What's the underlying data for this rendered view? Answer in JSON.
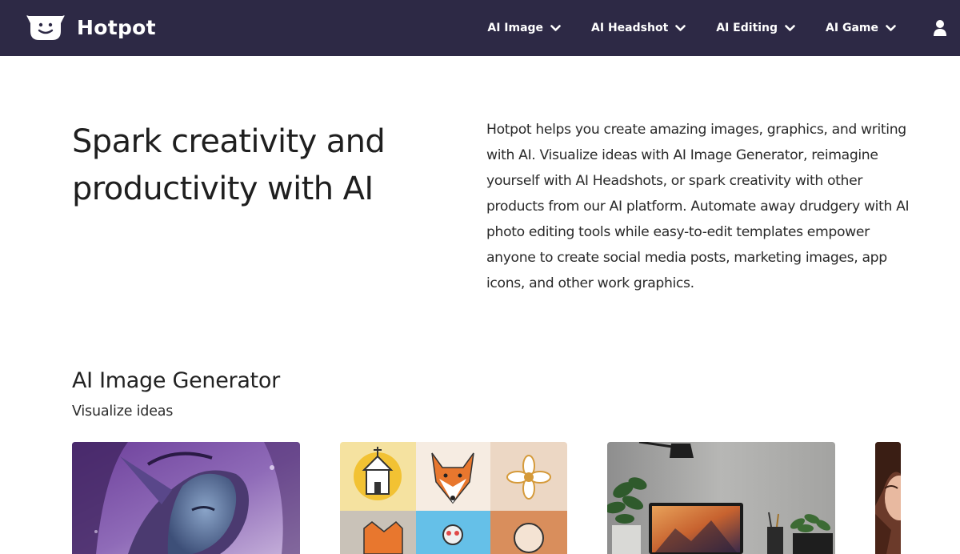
{
  "header": {
    "brand": "Hotpot",
    "logo_icon": "smiling-pot-icon",
    "nav": [
      {
        "label": "AI Image"
      },
      {
        "label": "AI Headshot"
      },
      {
        "label": "AI Editing"
      },
      {
        "label": "AI Game"
      }
    ],
    "user_icon": "user-icon"
  },
  "hero": {
    "title": "Spark creativity and productivity with AI",
    "description": "Hotpot helps you create amazing images, graphics, and writing with AI. Visualize ideas with AI Image Generator, reimagine yourself with AI Headshots, or spark creativity with other products from our AI platform. Automate away drudgery with AI photo editing tools while easy-to-edit templates empower anyone to create social media posts, marketing images, app icons, and other work graphics."
  },
  "section": {
    "title": "AI Image Generator",
    "subtitle": "Visualize ideas"
  },
  "colors": {
    "navbar_bg": "#2d2945",
    "nav_text": "#ffffff",
    "body_bg": "#ffffff"
  }
}
